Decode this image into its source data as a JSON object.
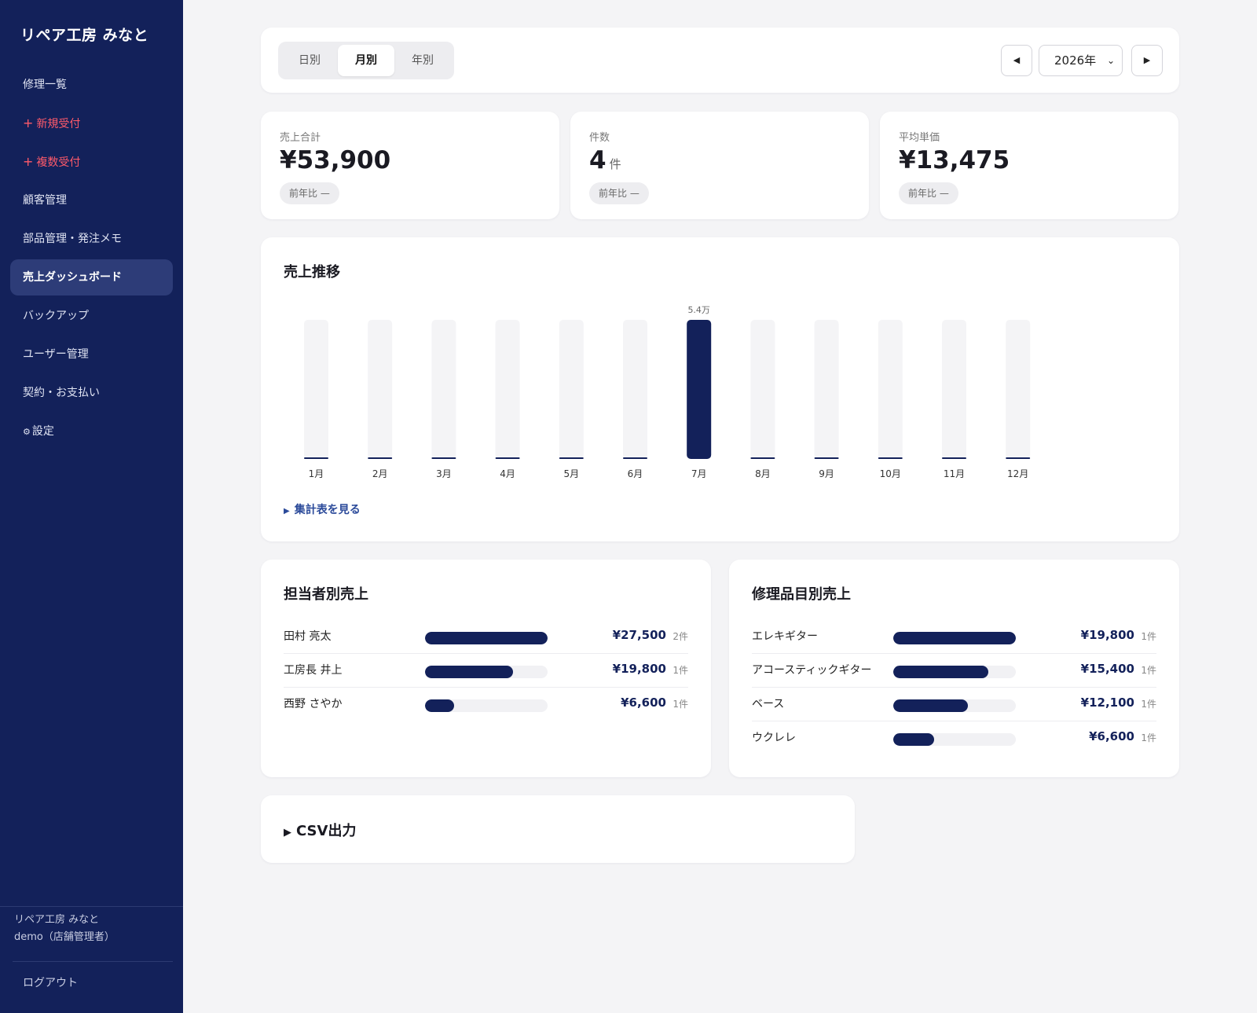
{
  "sidebar": {
    "brand": "リペア工房 みなと",
    "items": [
      {
        "label": "修理一覧",
        "icon": ""
      },
      {
        "label": "新規受付",
        "icon": "+"
      },
      {
        "label": "複数受付",
        "icon": "+"
      },
      {
        "label": "顧客管理",
        "icon": ""
      },
      {
        "label": "部品管理・発注メモ",
        "icon": ""
      },
      {
        "label": "売上ダッシュボード",
        "icon": ""
      },
      {
        "label": "バックアップ",
        "icon": ""
      },
      {
        "label": "ユーザー管理",
        "icon": ""
      },
      {
        "label": "契約・お支払い",
        "icon": ""
      },
      {
        "label": "設定",
        "icon": "⚙"
      }
    ],
    "shop_name": "リペア工房 みなと",
    "user": "demo（店舗管理者）",
    "logout": "ログアウト"
  },
  "toolbar": {
    "periods": [
      "日別",
      "月別",
      "年別"
    ],
    "active_period": "月別",
    "prev": "◀",
    "next": "▶",
    "year": "2026年"
  },
  "kpis": [
    {
      "label": "売上合計",
      "value": "¥53,900",
      "unit": "",
      "badge": "前年比 —"
    },
    {
      "label": "件数",
      "value": "4",
      "unit": "件",
      "badge": "前年比 —"
    },
    {
      "label": "平均単価",
      "value": "¥13,475",
      "unit": "",
      "badge": "前年比 —"
    }
  ],
  "chart_section": {
    "title": "売上推移",
    "summary_link": "集計表を見る",
    "summary_icon": "▶"
  },
  "chart_data": {
    "type": "bar",
    "categories": [
      "1月",
      "2月",
      "3月",
      "4月",
      "5月",
      "6月",
      "7月",
      "8月",
      "9月",
      "10月",
      "11月",
      "12月"
    ],
    "values": [
      0,
      0,
      0,
      0,
      0,
      0,
      53900,
      0,
      0,
      0,
      0,
      0
    ],
    "data_labels": [
      "",
      "",
      "",
      "",
      "",
      "",
      "5.4万",
      "",
      "",
      "",
      "",
      ""
    ],
    "ylim": [
      0,
      53900
    ],
    "grid": false,
    "bar_color": "#13215a",
    "track_color": "#f4f4f6"
  },
  "staff_sales": {
    "title": "担当者別売上",
    "rows": [
      {
        "name": "田村 亮太",
        "amount": "¥27,500",
        "count": "2件",
        "value": 27500
      },
      {
        "name": "工房長 井上",
        "amount": "¥19,800",
        "count": "1件",
        "value": 19800
      },
      {
        "name": "西野 さやか",
        "amount": "¥6,600",
        "count": "1件",
        "value": 6600
      }
    ]
  },
  "item_sales": {
    "title": "修理品目別売上",
    "rows": [
      {
        "name": "エレキギター",
        "amount": "¥19,800",
        "count": "1件",
        "value": 19800
      },
      {
        "name": "アコースティックギター",
        "amount": "¥15,400",
        "count": "1件",
        "value": 15400
      },
      {
        "name": "ベース",
        "amount": "¥12,100",
        "count": "1件",
        "value": 12100
      },
      {
        "name": "ウクレレ",
        "amount": "¥6,600",
        "count": "1件",
        "value": 6600
      }
    ]
  },
  "csv": {
    "title": "CSV出力",
    "icon": "▶"
  },
  "colors": {
    "sidebar_bg": "#13215a",
    "accent": "#13215a",
    "danger": "#ff5a6a",
    "link": "#2b4a9a"
  }
}
